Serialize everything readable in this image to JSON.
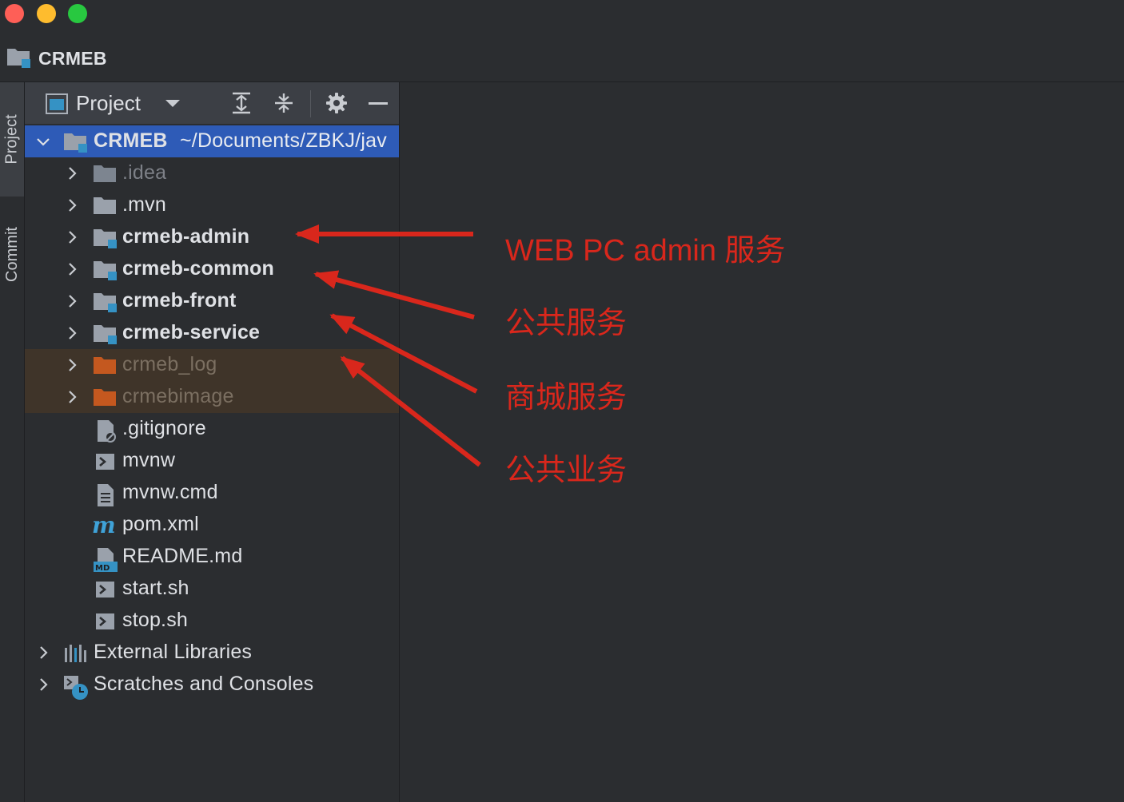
{
  "window": {
    "project_name": "CRMEB"
  },
  "side_tabs": [
    {
      "label": "Project"
    },
    {
      "label": "Commit"
    }
  ],
  "panel": {
    "title": "Project"
  },
  "tree": {
    "root": {
      "name": "CRMEB",
      "path": "~/Documents/ZBKJ/jav"
    },
    "items": [
      {
        "label": ".idea"
      },
      {
        "label": ".mvn"
      },
      {
        "label": "crmeb-admin"
      },
      {
        "label": "crmeb-common"
      },
      {
        "label": "crmeb-front"
      },
      {
        "label": "crmeb-service"
      },
      {
        "label": "crmeb_log"
      },
      {
        "label": "crmebimage"
      },
      {
        "label": ".gitignore"
      },
      {
        "label": "mvnw"
      },
      {
        "label": "mvnw.cmd"
      },
      {
        "label": "pom.xml"
      },
      {
        "label": "README.md"
      },
      {
        "label": "start.sh"
      },
      {
        "label": "stop.sh"
      },
      {
        "label": "External Libraries"
      },
      {
        "label": "Scratches and Consoles"
      }
    ]
  },
  "annotations": [
    {
      "text": "WEB PC admin 服务"
    },
    {
      "text": "公共服务"
    },
    {
      "text": "商城服务"
    },
    {
      "text": "公共业务"
    }
  ],
  "colors": {
    "background": "#2b2d30",
    "selection": "#2e5bb7",
    "excluded_bg": "#3f3429",
    "module_badge": "#3592c4",
    "excluded_folder": "#c4581f",
    "annotation": "#d9271c"
  },
  "icons": {
    "panel": "project-view-icon",
    "header_actions": [
      "expand-all-icon",
      "collapse-all-icon",
      "gear-icon",
      "minimize-icon"
    ]
  }
}
